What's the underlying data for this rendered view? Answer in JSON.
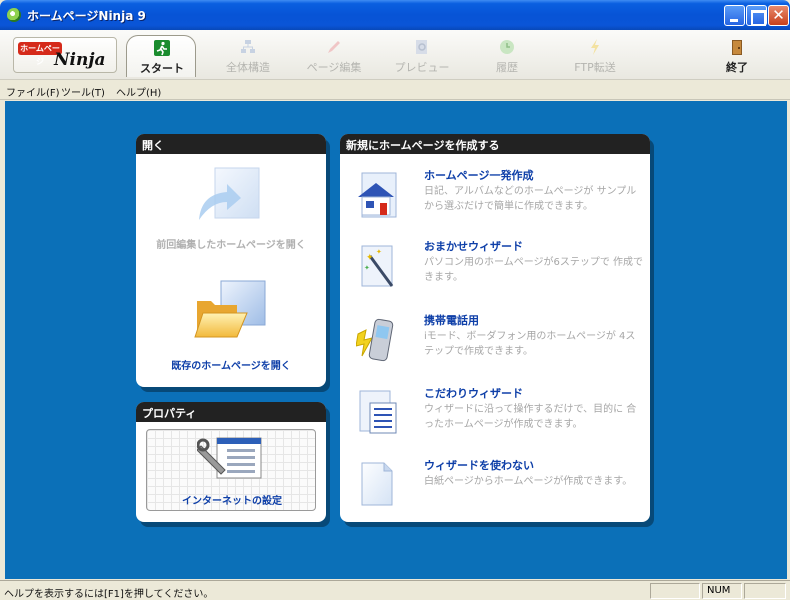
{
  "window": {
    "title": "ホームページNinja 9"
  },
  "logo": {
    "badge": "ホームページ",
    "script": "Ninja"
  },
  "toolbar": {
    "items": [
      {
        "label": "スタート"
      },
      {
        "label": "全体構造"
      },
      {
        "label": "ページ編集"
      },
      {
        "label": "プレビュー"
      },
      {
        "label": "履歴"
      },
      {
        "label": "FTP転送"
      },
      {
        "label": "終了"
      }
    ]
  },
  "menu": {
    "items": [
      "ファイル(F)",
      "ツール(T)",
      "ヘルプ(H)"
    ]
  },
  "open_panel": {
    "title": "開く",
    "recent_label": "前回編集したホームページを開く",
    "existing_label": "既存のホームページを開く"
  },
  "property_panel": {
    "title": "プロパティ",
    "settings_label": "インターネットの設定"
  },
  "new_panel": {
    "title": "新規にホームページを作成する",
    "items": [
      {
        "title": "ホームページ一発作成",
        "desc": "日記、アルバムなどのホームページが サンプルから選ぶだけで簡単に作成できます。"
      },
      {
        "title": "おまかせウィザード",
        "desc": "パソコン用のホームページが6ステップで 作成できます。"
      },
      {
        "title": "携帯電話用",
        "desc": "iモード、ボーダフォン用のホームページが 4ステップで作成できます。"
      },
      {
        "title": "こだわりウィザード",
        "desc": "ウィザードに沿って操作するだけで、目的に 合ったホームページが作成できます。"
      },
      {
        "title": "ウィザードを使わない",
        "desc": "白紙ページからホームページが作成できます。"
      }
    ]
  },
  "statusbar": {
    "text": "ヘルプを表示するには[F1]を押してください。",
    "num": "NUM"
  },
  "colors": {
    "titlebar": "#0754d6",
    "workspace": "#0b70b8",
    "link": "#0e3fa8",
    "panel_header": "#222222"
  }
}
